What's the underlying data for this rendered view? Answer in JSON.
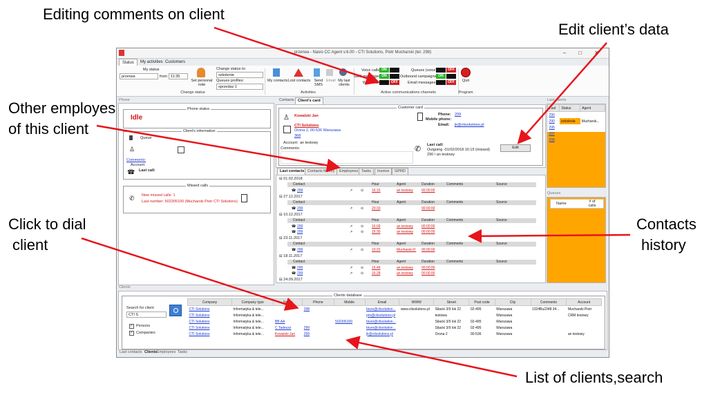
{
  "annotations": {
    "editing_comments": "Editing comments on client",
    "edit_client": "Edit client’s data",
    "other_employees_1": "Other employes",
    "other_employees_2": "of this client",
    "click_to_dial_1": "Click to dial",
    "click_to_dial_2": "client",
    "contacts_history_1": "Contacts",
    "contacts_history_2": "history",
    "list_of_clients": "List of clients,search"
  },
  "window": {
    "title": "przerwa - Nasio CC Agent v.6.00 - CTI Solutions, Piotr Mucharski (tel. 298)",
    "controls": "– □ ✕"
  },
  "ribbon_tabs": [
    "Status",
    "My activities",
    "Customers"
  ],
  "ribbon": {
    "my_status_label": "My status",
    "my_status_value": "przerwa",
    "from_label": "from",
    "from_value": "11:35",
    "set_personal_note": "Set personal note",
    "change_status_to_label": "Change status to:",
    "change_status_to_value": "szkolenie",
    "queues_profiles_label": "Queues profiles:",
    "queues_profiles_value": "sprzedaz 1",
    "change_status_group": "Change status",
    "my_contacts": "My contacts",
    "lost_contacts": "Lost contacts",
    "send_sms": "Send SMS",
    "email": "Email",
    "my_last_clients": "My last clients",
    "activities_group": "Activities",
    "voice_calls": "Voice calls",
    "sms_messages": "SMS messages",
    "web_chat": "Web chat",
    "queues_voice": "Queues (voice)",
    "outbound_campaigns": "Outbound campaigns",
    "email_messages": "Email messages",
    "on": "ON",
    "off": "OFF",
    "channels_group": "Active communications channels",
    "quit": "Quit",
    "program_group": "Program"
  },
  "phone_panel": {
    "title": "Phone",
    "phone_status_legend": "Phone status",
    "status": "Idle",
    "client_info_legend": "Client's information",
    "queue_label": "Queue",
    "comments_link": "Comments:",
    "account_label": "Account:",
    "last_call_label": "Last call:",
    "missed_calls_legend": "Missed calls",
    "new_missed_calls": "New missed calls: 1",
    "last_number": "Last number: 502305100 (Mucharski Piotr CTI Solutions)"
  },
  "customer_card": {
    "tabs": [
      "Contacts",
      "Client's card"
    ],
    "legend": "Customer card",
    "person_name": "Kowalski Jan",
    "company": "CTI Solutions",
    "address": "Orona 2, 00-536 Warszawa",
    "company_id": "368",
    "account_label": "Account:",
    "account_value": "an testowy",
    "comments_label": "Comments:",
    "phone_label": "Phone:",
    "phone_value": "299",
    "mobile_label": "Mobile phone:",
    "email_label": "Email:",
    "email_value": "jk@ctisolutions.pl",
    "last_call_label": "Last call:",
    "last_call_line1": "Outgoing -01/02/2018 16:15 (missed)",
    "last_call_line2": "290 / an testowy",
    "edit_button": "Edit"
  },
  "history_tabs": [
    "Last contacts",
    "Contacts history",
    "Employees",
    "Tasks",
    "Invoice",
    "GPRD"
  ],
  "history_columns": {
    "contact": "Contact",
    "hour": "Hour",
    "agent": "Agent",
    "duration": "Duration",
    "comments": "Comments",
    "source": "Source"
  },
  "history": [
    {
      "date": "01.02.2018",
      "rows": [
        {
          "num": "299",
          "hour": "16:15",
          "agent": "an testowy",
          "duration": "00:00:00"
        }
      ]
    },
    {
      "date": "27.12.2017",
      "rows": [
        {
          "num": "299",
          "hour": "20:33",
          "agent": "",
          "duration": "00:00:00"
        }
      ]
    },
    {
      "date": "10.12.2017",
      "rows": [
        {
          "num": "299",
          "hour": "16:09",
          "agent": "an testowy",
          "duration": "00:00:00"
        },
        {
          "num": "299",
          "hour": "16:30",
          "agent": "an testowy",
          "duration": "00:00:00"
        }
      ]
    },
    {
      "date": "23.11.2017",
      "rows": [
        {
          "num": "299",
          "hour": "10:22",
          "agent": "Mucharski P.",
          "duration": "00:00:00"
        }
      ]
    },
    {
      "date": "18.11.2017",
      "rows": [
        {
          "num": "299",
          "hour": "16:49",
          "agent": "an testowy",
          "duration": "00:00:00"
        },
        {
          "num": "299",
          "hour": "16:28",
          "agent": "an testowy",
          "duration": "00:00:00"
        }
      ]
    },
    {
      "date": "24.09.2017",
      "rows": []
    }
  ],
  "last_clients": {
    "title": "Last clients",
    "columns": [
      "Last",
      "Status",
      "Agent"
    ],
    "rows": [
      {
        "num": "290",
        "status": "",
        "agent": ""
      },
      {
        "num": "290",
        "status": "szkolenie",
        "agent": "Mucharsk..."
      },
      {
        "num": "295",
        "status": "",
        "agent": ""
      },
      {
        "num": "297",
        "status": "",
        "agent": ""
      },
      {
        "num": "299",
        "status": "",
        "agent": ""
      }
    ]
  },
  "queues": {
    "title": "Queues",
    "col_name": "Name",
    "col_calls": "# of calls"
  },
  "clients": {
    "title": "Clients",
    "legend": "Clients database",
    "search_label": "Search for client",
    "search_value": "CTI S",
    "persons": "Persons",
    "companies": "Companies",
    "columns": [
      "Company",
      "Company type",
      "Name",
      "Phone",
      "Mobile",
      "Email",
      "WWW",
      "Street",
      "Post code",
      "City",
      "Comments",
      "Account"
    ],
    "rows": [
      [
        "CTI Solutions",
        "Informatyka & tele...",
        "",
        "298",
        "",
        "biuro@ctisolution...",
        "www.ctisolutions.pl",
        "Silacki 3/9 lok 22",
        "02-495",
        "Warszawa",
        "1324Bu2348 34...",
        "Mucharski Piotr"
      ],
      [
        "CTI Solutions",
        "Informatyka & tele...",
        "",
        "",
        "",
        "pm@ctisolutions.pl",
        "",
        "testowa",
        "",
        "Warszawa",
        "",
        "CRM testowy"
      ],
      [
        "CTI Solutions",
        "Informatyka & tele...",
        "BB AA",
        "",
        "502306100",
        "biuro@ctisolution...",
        "",
        "Silacki 3/9 lok 22",
        "02-495",
        "Warszawa",
        "",
        ""
      ],
      [
        "CTI Solutions",
        "Informatyka & tele...",
        "C Tadeusz",
        "299",
        "",
        "biuro@ctisolution...",
        "",
        "Silacki 3/9 lok 22",
        "02-495",
        "Warszawa",
        "",
        ""
      ],
      [
        "CTI Solutions",
        "Informatyka & tele...",
        "Kowalski Jan",
        "299",
        "",
        "jk@ctisolutions.pl",
        "",
        "Orona 2",
        "00-536",
        "Warszawa",
        "",
        "an testowy"
      ]
    ],
    "bottom_tabs": [
      "Last contacts",
      "Clients",
      "Employees",
      "Tasks"
    ]
  },
  "colors": {
    "arrow": "#e8141b",
    "queue_panel": "#ffa500",
    "on": "#2db52d",
    "off": "#d02020"
  }
}
